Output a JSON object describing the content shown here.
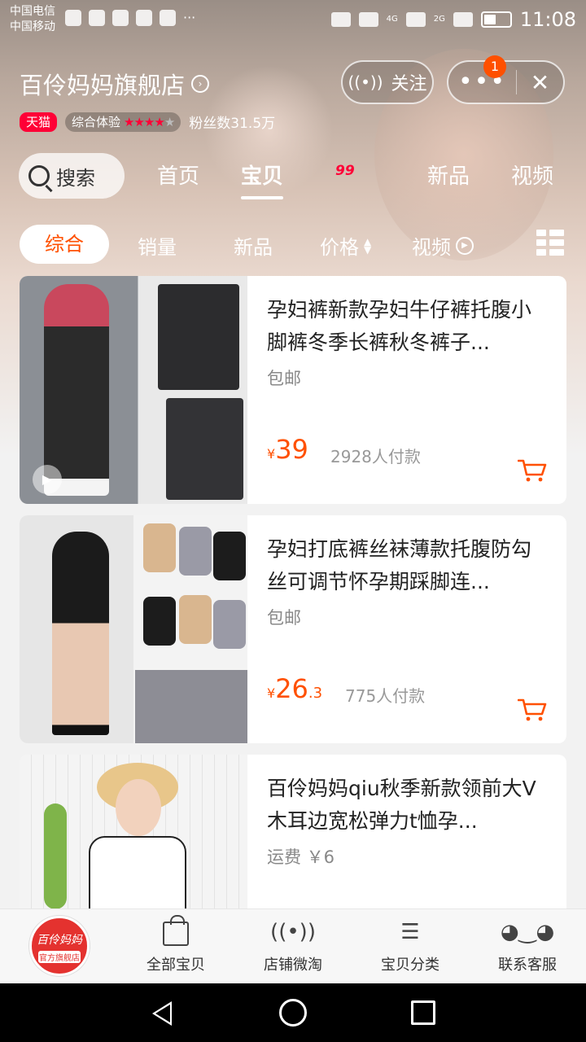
{
  "status_bar": {
    "carrier_1": "中国电信",
    "carrier_2": "中国移动",
    "time": "11:08",
    "network_1": "4G",
    "network_2": "2G",
    "icons": [
      "heart-pulse-icon",
      "wechat-icon",
      "shield-icon",
      "paw-icon",
      "bag-icon",
      "more-dots-icon",
      "eye-icon",
      "wifi-icon",
      "signal-icon",
      "battery-icon"
    ]
  },
  "store": {
    "name": "百伶妈妈旗舰店",
    "tmall_label": "天猫",
    "experience_label": "综合体验",
    "rating_stars": 4,
    "rating_max": 5,
    "fans": "粉丝数31.5万",
    "follow_label": "关注",
    "notification_count": "1"
  },
  "tabs": {
    "search_label": "搜索",
    "items": [
      "首页",
      "宝贝",
      "99",
      "新品",
      "视频"
    ],
    "promo_label": "99",
    "active": "宝贝"
  },
  "sort": {
    "items": [
      "综合",
      "销量",
      "新品",
      "价格",
      "视频"
    ],
    "active": "综合"
  },
  "products": [
    {
      "title": "孕妇裤新款孕妇牛仔裤托腹小脚裤冬季长裤秋冬裤子...",
      "shipping": "包邮",
      "price_symbol": "¥",
      "price_int": "39",
      "price_dec": "",
      "sold": "2928人付款"
    },
    {
      "title": "孕妇打底裤丝袜薄款托腹防勾丝可调节怀孕期踩脚连...",
      "shipping": "包邮",
      "price_symbol": "¥",
      "price_int": "26",
      "price_dec": ".3",
      "sold": "775人付款"
    },
    {
      "title": "百伶妈妈qiu秋季新款领前大V木耳边宽松弹力t恤孕...",
      "shipping": "运费 ￥6"
    }
  ],
  "bottom_bar": {
    "logo_line1": "百伶妈妈",
    "logo_line2": "官方旗舰店",
    "items": [
      "全部宝贝",
      "店铺微淘",
      "宝贝分类",
      "联系客服"
    ]
  },
  "colors": {
    "accent": "#ff5000",
    "tmall_red": "#ff0036"
  }
}
